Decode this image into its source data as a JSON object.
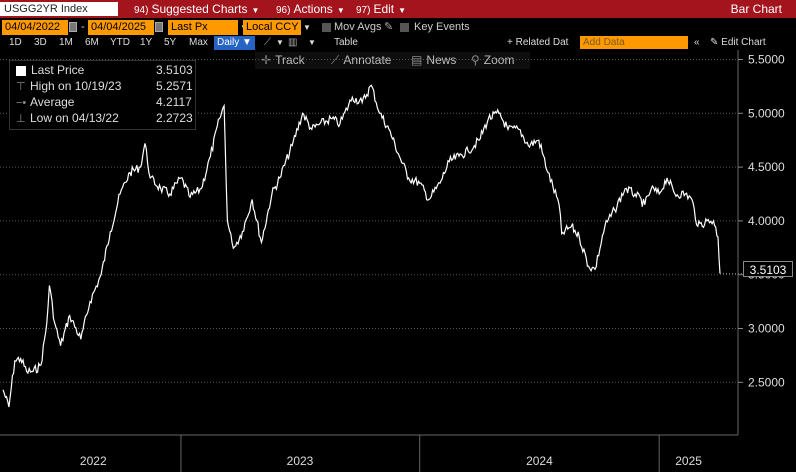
{
  "topbar": {
    "ticker": "USGG2YR Index",
    "suggested_num": "94)",
    "suggested_label": "Suggested Charts",
    "actions_num": "96)",
    "actions_label": "Actions",
    "edit_num": "97)",
    "edit_label": "Edit",
    "chart_type": "Bar Chart"
  },
  "controls": {
    "start_date": "04/04/2022",
    "end_date": "04/04/2025",
    "field": "Last Px",
    "currency": "Local CCY",
    "mov_avgs": "Mov Avgs",
    "key_events": "Key Events"
  },
  "ranges": [
    "1D",
    "3D",
    "1M",
    "6M",
    "YTD",
    "1Y",
    "5Y",
    "Max"
  ],
  "frequency": "Daily",
  "toolbar": {
    "table": "Table",
    "related": "+ Related Dat",
    "add_data_placeholder": "Add Data",
    "edit_chart": "Edit Chart"
  },
  "tools": {
    "track": "Track",
    "annotate": "Annotate",
    "news": "News",
    "zoom": "Zoom"
  },
  "legend": {
    "last_label": "Last Price",
    "last_value": "3.5103",
    "high_label": "High on 10/19/23",
    "high_value": "5.2571",
    "avg_label": "Average",
    "avg_value": "4.2117",
    "low_label": "Low on 04/13/22",
    "low_value": "2.2723"
  },
  "last_value_label": "3.5103",
  "colors": {
    "top_bar": "#a4141d",
    "field_bg": "#ff9900",
    "selected": "#2664c4",
    "line": "#ffffff"
  },
  "chart_data": {
    "type": "line",
    "x_axis_labels": [
      "2022",
      "2023",
      "2024",
      "2025"
    ],
    "y_ticks": [
      "5.5000",
      "5.0000",
      "4.5000",
      "4.0000",
      "3.5000",
      "3.0000",
      "2.5000"
    ],
    "ylim": [
      2.0,
      5.55
    ],
    "series": [
      {
        "points": [
          [
            "2022-04-04",
            2.43
          ],
          [
            "2022-04-13",
            2.27
          ],
          [
            "2022-04-22",
            2.7
          ],
          [
            "2022-05-01",
            2.72
          ],
          [
            "2022-05-10",
            2.6
          ],
          [
            "2022-05-20",
            2.6
          ],
          [
            "2022-06-01",
            2.66
          ],
          [
            "2022-06-10",
            3.05
          ],
          [
            "2022-06-14",
            3.4
          ],
          [
            "2022-06-22",
            3.05
          ],
          [
            "2022-07-01",
            2.84
          ],
          [
            "2022-07-15",
            3.12
          ],
          [
            "2022-08-01",
            2.9
          ],
          [
            "2022-08-15",
            3.25
          ],
          [
            "2022-09-01",
            3.5
          ],
          [
            "2022-09-15",
            3.9
          ],
          [
            "2022-09-30",
            4.25
          ],
          [
            "2022-10-15",
            4.45
          ],
          [
            "2022-10-31",
            4.5
          ],
          [
            "2022-11-07",
            4.72
          ],
          [
            "2022-11-15",
            4.4
          ],
          [
            "2022-12-01",
            4.3
          ],
          [
            "2022-12-15",
            4.25
          ],
          [
            "2023-01-01",
            4.4
          ],
          [
            "2023-01-15",
            4.22
          ],
          [
            "2023-02-01",
            4.3
          ],
          [
            "2023-02-15",
            4.6
          ],
          [
            "2023-03-01",
            4.95
          ],
          [
            "2023-03-08",
            5.07
          ],
          [
            "2023-03-13",
            4.0
          ],
          [
            "2023-03-20",
            3.8
          ],
          [
            "2023-03-24",
            3.76
          ],
          [
            "2023-04-05",
            3.9
          ],
          [
            "2023-04-20",
            4.2
          ],
          [
            "2023-05-04",
            3.8
          ],
          [
            "2023-05-20",
            4.25
          ],
          [
            "2023-06-01",
            4.4
          ],
          [
            "2023-06-20",
            4.7
          ],
          [
            "2023-07-06",
            5.0
          ],
          [
            "2023-07-20",
            4.85
          ],
          [
            "2023-08-01",
            4.9
          ],
          [
            "2023-08-20",
            4.95
          ],
          [
            "2023-09-01",
            4.9
          ],
          [
            "2023-09-20",
            5.15
          ],
          [
            "2023-10-05",
            5.1
          ],
          [
            "2023-10-19",
            5.26
          ],
          [
            "2023-11-01",
            5.0
          ],
          [
            "2023-11-15",
            4.85
          ],
          [
            "2023-12-01",
            4.6
          ],
          [
            "2023-12-15",
            4.4
          ],
          [
            "2024-01-01",
            4.35
          ],
          [
            "2024-01-15",
            4.2
          ],
          [
            "2024-02-01",
            4.35
          ],
          [
            "2024-02-15",
            4.55
          ],
          [
            "2024-03-01",
            4.6
          ],
          [
            "2024-03-15",
            4.65
          ],
          [
            "2024-04-01",
            4.75
          ],
          [
            "2024-04-15",
            4.95
          ],
          [
            "2024-05-01",
            5.0
          ],
          [
            "2024-05-15",
            4.85
          ],
          [
            "2024-06-01",
            4.85
          ],
          [
            "2024-06-15",
            4.7
          ],
          [
            "2024-07-01",
            4.75
          ],
          [
            "2024-07-15",
            4.45
          ],
          [
            "2024-08-01",
            4.15
          ],
          [
            "2024-08-05",
            3.88
          ],
          [
            "2024-08-20",
            3.95
          ],
          [
            "2024-09-01",
            3.85
          ],
          [
            "2024-09-15",
            3.58
          ],
          [
            "2024-09-25",
            3.55
          ],
          [
            "2024-10-10",
            3.95
          ],
          [
            "2024-10-25",
            4.1
          ],
          [
            "2024-11-10",
            4.3
          ],
          [
            "2024-11-25",
            4.25
          ],
          [
            "2024-12-10",
            4.15
          ],
          [
            "2024-12-20",
            4.3
          ],
          [
            "2025-01-01",
            4.25
          ],
          [
            "2025-01-13",
            4.4
          ],
          [
            "2025-01-25",
            4.25
          ],
          [
            "2025-02-10",
            4.25
          ],
          [
            "2025-02-20",
            4.2
          ],
          [
            "2025-03-01",
            3.95
          ],
          [
            "2025-03-15",
            4.0
          ],
          [
            "2025-03-25",
            4.0
          ],
          [
            "2025-04-01",
            3.85
          ],
          [
            "2025-04-04",
            3.51
          ]
        ]
      }
    ]
  }
}
